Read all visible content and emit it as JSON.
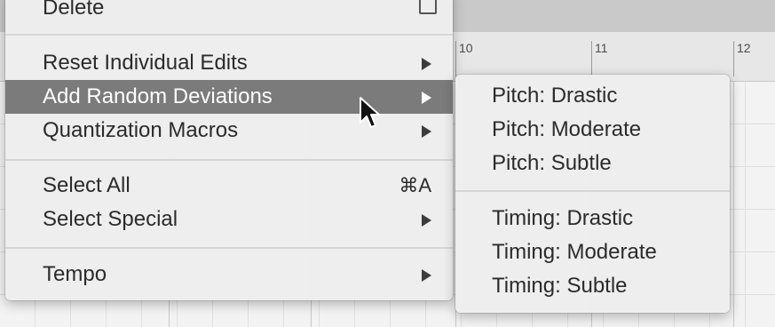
{
  "ruler": {
    "marks": [
      "10",
      "11",
      "12"
    ]
  },
  "main_menu": {
    "delete_label": "Delete",
    "reset_label": "Reset Individual Edits",
    "random_label": "Add Random Deviations",
    "quantize_label": "Quantization Macros",
    "select_all_label": "Select All",
    "select_all_shortcut": "⌘A",
    "select_special_label": "Select Special",
    "tempo_label": "Tempo"
  },
  "sub_menu": {
    "pitch_drastic": "Pitch: Drastic",
    "pitch_moderate": "Pitch: Moderate",
    "pitch_subtle": "Pitch: Subtle",
    "timing_drastic": "Timing: Drastic",
    "timing_moderate": "Timing: Moderate",
    "timing_subtle": "Timing: Subtle"
  },
  "colors": {
    "highlight": "#7b7b7b",
    "menu_bg": "#eeeeee"
  },
  "icons": [
    "trash-icon",
    "submenu-arrow-icon",
    "pointer-cursor-icon"
  ]
}
